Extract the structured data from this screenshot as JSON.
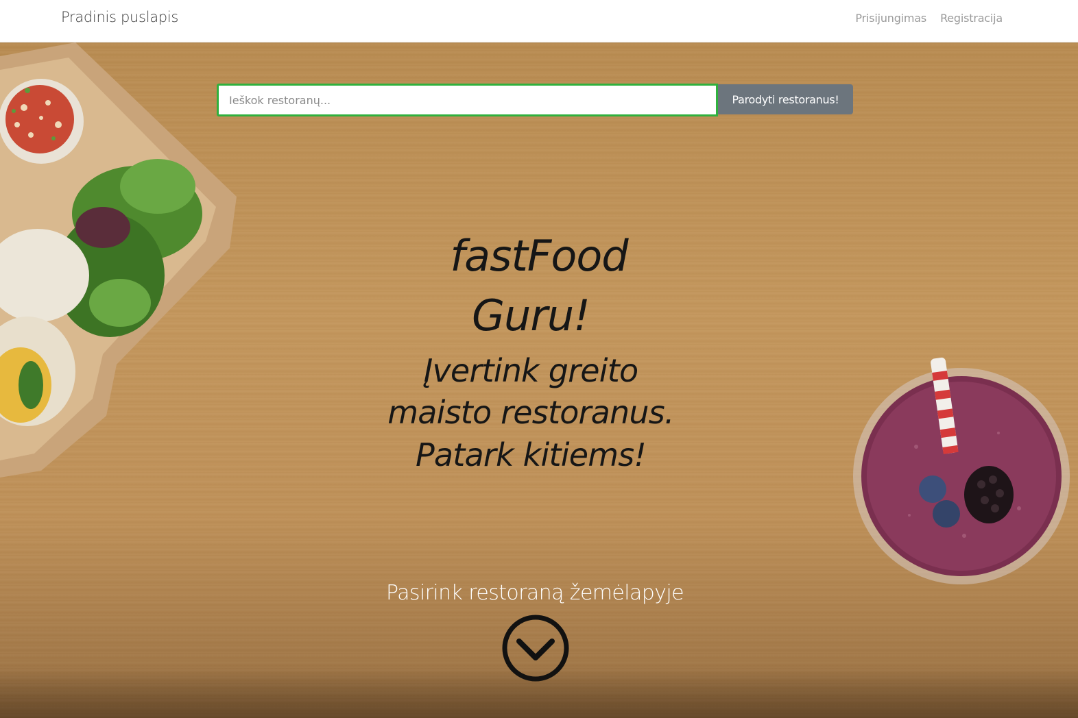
{
  "navbar": {
    "brand": "Pradinis puslapis",
    "links": [
      {
        "label": "Prisijungimas"
      },
      {
        "label": "Registracija"
      }
    ]
  },
  "search": {
    "placeholder": "Ieškok restoranų...",
    "button_label": "Parodyti restoranus!",
    "border_color": "#2fb13e",
    "button_color": "#6c757d"
  },
  "hero": {
    "title_line1": "fastFood",
    "title_line2": "Guru!",
    "subtitle_line1": "Įvertink greito",
    "subtitle_line2": "maisto restoranus.",
    "subtitle_line3": "Patark kitiems!",
    "map_cta": "Pasirink restoraną žemėlapyje",
    "scroll_icon": "chevron-down-circle-icon"
  }
}
